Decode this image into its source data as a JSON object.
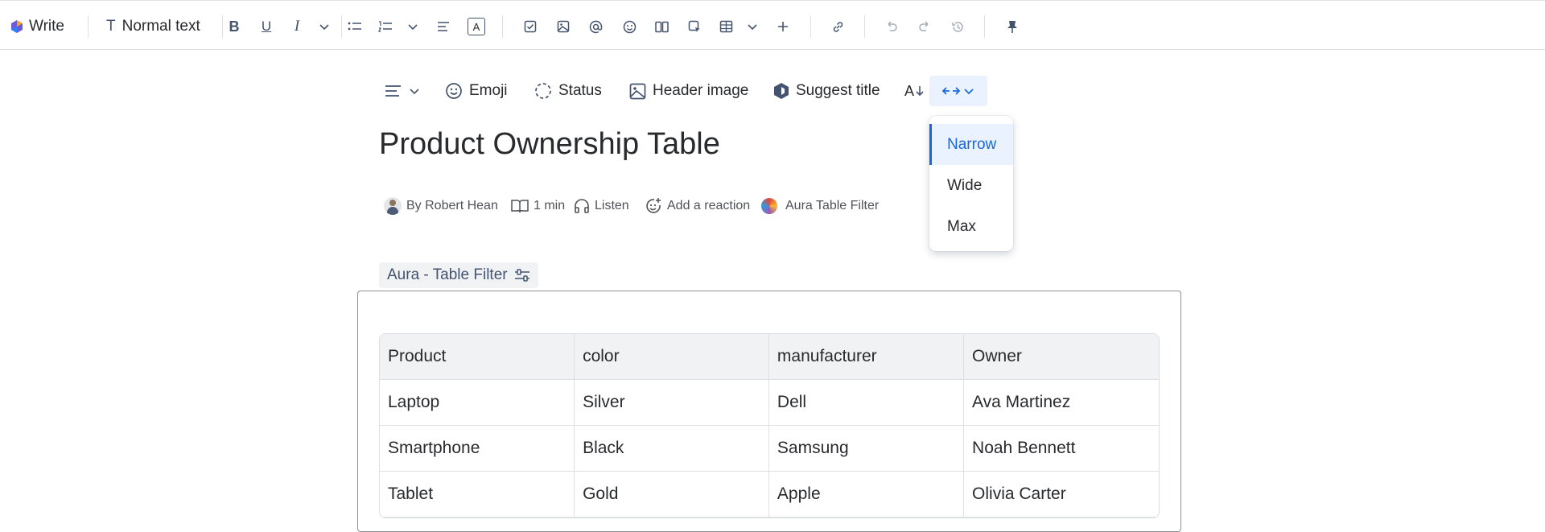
{
  "toolbar": {
    "write_label": "Write",
    "text_style_label": "Normal text",
    "bold_label": "B",
    "underline_label": "U",
    "italic_label": "I",
    "text_color_label": "A",
    "icons": [
      "write-logo-icon",
      "text-style-icon",
      "bold-icon",
      "underline-icon",
      "italic-icon",
      "chevron-down-icon",
      "bullet-list-icon",
      "numbered-list-icon",
      "align-icon",
      "text-color-icon",
      "action-item-icon",
      "image-icon",
      "mention-icon",
      "emoji-icon",
      "layout-icon",
      "insert-element-icon",
      "table-icon",
      "plus-icon",
      "link-icon",
      "undo-icon",
      "redo-icon",
      "history-icon",
      "pin-icon"
    ]
  },
  "page_header": {
    "emoji_label": "Emoji",
    "status_label": "Status",
    "header_image_label": "Header image",
    "suggest_title_label": "Suggest title",
    "text_size_label": "A"
  },
  "width_menu": {
    "options": [
      "Narrow",
      "Wide",
      "Max"
    ],
    "selected": "Narrow",
    "accent": "#1868db"
  },
  "page": {
    "title": "Product Ownership Table",
    "byline": {
      "author": "By Robert Hean",
      "read_time": "1 min",
      "listen": "Listen",
      "reaction": "Add a reaction",
      "app": "Aura Table Filter"
    }
  },
  "aura_filter": {
    "label": "Aura - Table Filter"
  },
  "table": {
    "headers": [
      "Product",
      "color",
      "manufacturer",
      "Owner"
    ],
    "rows": [
      [
        "Laptop",
        "Silver",
        "Dell",
        "Ava Martinez"
      ],
      [
        "Smartphone",
        "Black",
        "Samsung",
        "Noah Bennett"
      ],
      [
        "Tablet",
        "Gold",
        "Apple",
        "Olivia Carter"
      ]
    ]
  }
}
